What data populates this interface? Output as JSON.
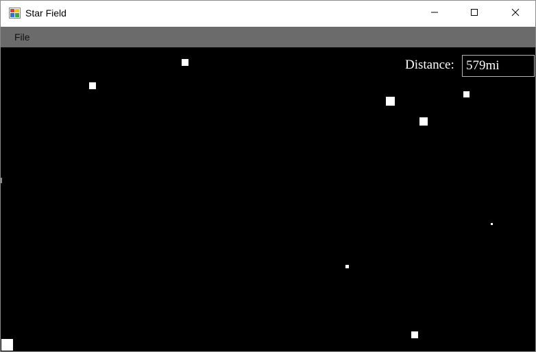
{
  "window": {
    "title": "Star Field",
    "icons": {
      "app": "winforms-app-icon",
      "minimize": "minimize-icon",
      "maximize": "maximize-icon",
      "close": "close-icon"
    }
  },
  "menu": {
    "items": [
      {
        "label": "File"
      }
    ]
  },
  "starfield": {
    "background": "#000000",
    "star_color": "#ffffff",
    "distance_label": "Distance:",
    "distance_value": "579mi"
  }
}
